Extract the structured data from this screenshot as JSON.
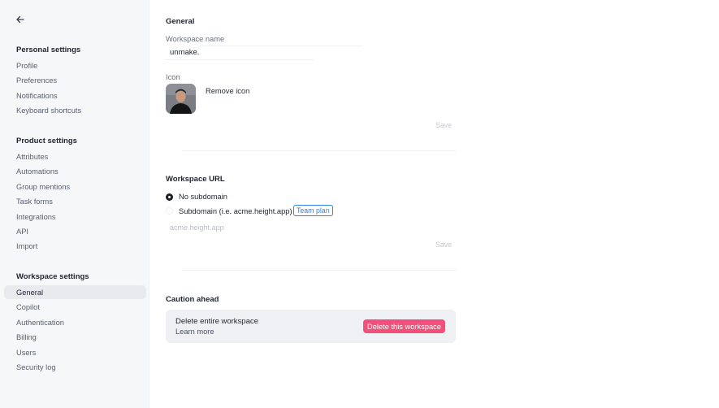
{
  "sidebar": {
    "back_icon": "arrow-left-icon",
    "sections": [
      {
        "title": "Personal settings",
        "items": [
          "Profile",
          "Preferences",
          "Notifications",
          "Keyboard shortcuts"
        ]
      },
      {
        "title": "Product settings",
        "items": [
          "Attributes",
          "Automations",
          "Group mentions",
          "Task forms",
          "Integrations",
          "API",
          "Import"
        ]
      },
      {
        "title": "Workspace settings",
        "items": [
          "General",
          "Copilot",
          "Authentication",
          "Billing",
          "Users",
          "Security log"
        ]
      }
    ],
    "active_item": "General"
  },
  "general": {
    "heading": "General",
    "workspace_name_label": "Workspace name",
    "workspace_name_value": "unmake.",
    "icon_label": "Icon",
    "remove_icon_label": "Remove icon",
    "save_label": "Save"
  },
  "workspace_url": {
    "heading": "Workspace URL",
    "option_no_subdomain": "No subdomain",
    "option_subdomain": "Subdomain (i.e. acme.height.app)",
    "selected": "No subdomain",
    "team_plan_badge": "Team plan",
    "subdomain_placeholder": "acme.height.app",
    "save_label": "Save"
  },
  "caution": {
    "heading": "Caution ahead",
    "delete_title": "Delete entire workspace",
    "learn_more": "Learn more",
    "delete_button": "Delete this workspace",
    "delete_color": "#f2507a"
  }
}
